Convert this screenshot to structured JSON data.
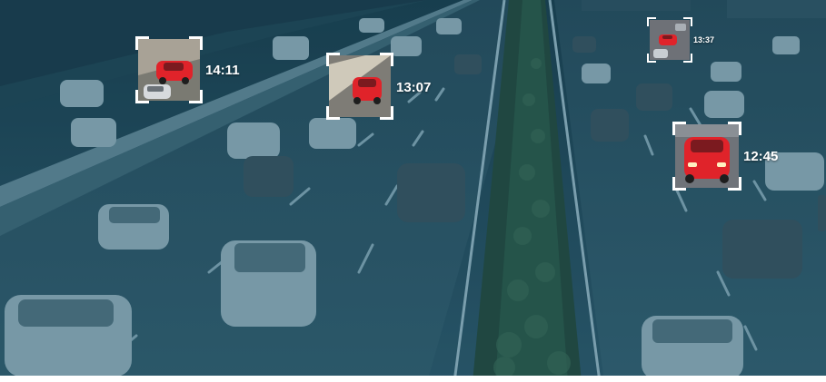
{
  "scene": {
    "description_colors": {
      "overlay": "#1c4b5e",
      "road": "#2a5264",
      "median": "#1e4036",
      "highlight_car": "#e0232a"
    }
  },
  "detections": [
    {
      "timestamp": "14:11",
      "icon": "red-car-thumbnail"
    },
    {
      "timestamp": "13:07",
      "icon": "red-car-thumbnail"
    },
    {
      "timestamp": "13:37",
      "icon": "red-car-thumbnail"
    },
    {
      "timestamp": "12:45",
      "icon": "red-car-thumbnail"
    }
  ]
}
